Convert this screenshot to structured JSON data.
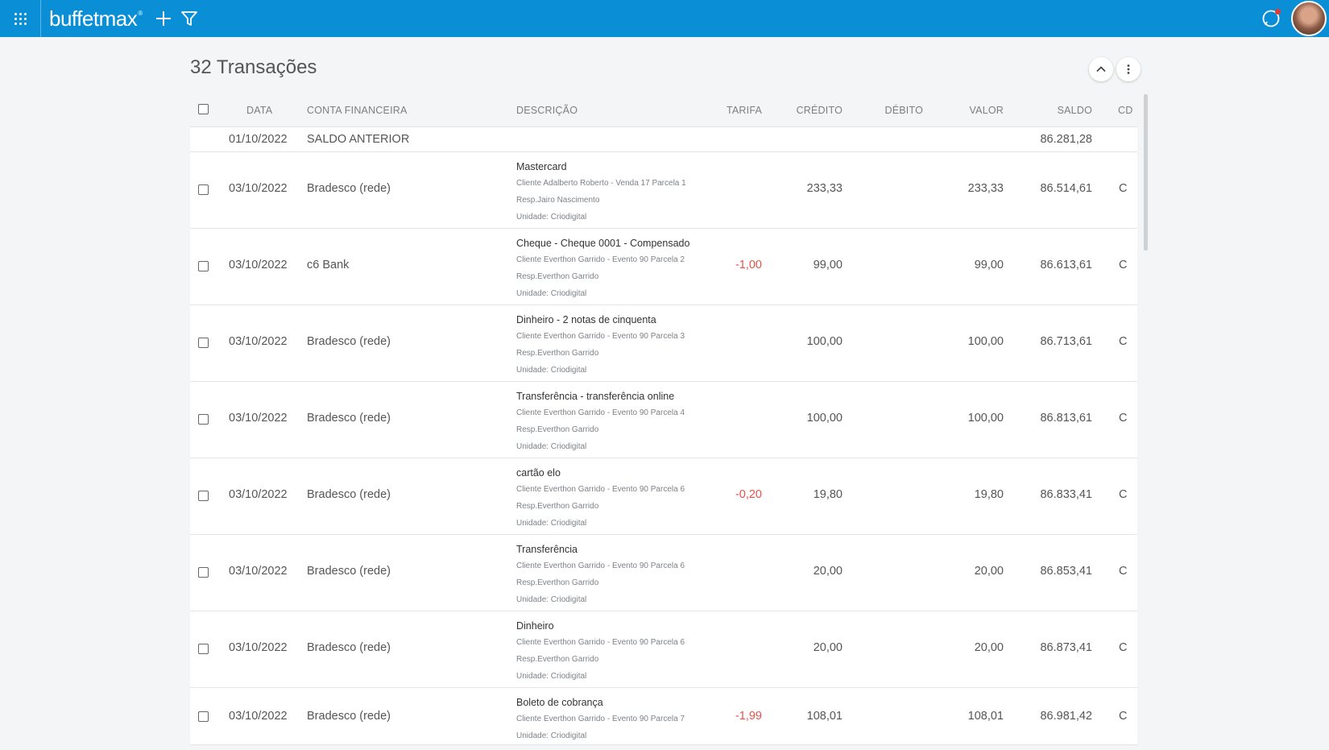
{
  "app": {
    "brand": "buffetmax",
    "brand_mark": "®"
  },
  "page": {
    "title": "32 Transações"
  },
  "table": {
    "headers": {
      "data": "DATA",
      "conta": "CONTA FINANCEIRA",
      "descricao": "DESCRIÇÃO",
      "tarifa": "TARIFA",
      "credito": "CRÉDITO",
      "debito": "DÉBITO",
      "valor": "VALOR",
      "saldo": "SALDO",
      "cd": "CD"
    },
    "opening": {
      "date": "01/10/2022",
      "label": "SALDO ANTERIOR",
      "saldo": "86.281,28"
    },
    "rows": [
      {
        "date": "03/10/2022",
        "account": "Bradesco (rede)",
        "desc": "Mastercard",
        "details": [
          "Cliente Adalberto Roberto - Venda 17 Parcela 1",
          "Resp.Jairo Nascimento",
          "Unidade: Criodigital"
        ],
        "tarifa": "",
        "credito": "233,33",
        "debito": "",
        "valor": "233,33",
        "saldo": "86.514,61",
        "cd": "C"
      },
      {
        "date": "03/10/2022",
        "account": "c6 Bank",
        "desc": "Cheque - Cheque 0001 - Compensado",
        "details": [
          "Cliente Everthon Garrido - Evento 90 Parcela 2",
          "Resp.Everthon Garrido",
          "Unidade: Criodigital"
        ],
        "tarifa": "-1,00",
        "credito": "99,00",
        "debito": "",
        "valor": "99,00",
        "saldo": "86.613,61",
        "cd": "C"
      },
      {
        "date": "03/10/2022",
        "account": "Bradesco (rede)",
        "desc": "Dinheiro - 2 notas de cinquenta",
        "details": [
          "Cliente Everthon Garrido - Evento 90 Parcela 3",
          "Resp.Everthon Garrido",
          "Unidade: Criodigital"
        ],
        "tarifa": "",
        "credito": "100,00",
        "debito": "",
        "valor": "100,00",
        "saldo": "86.713,61",
        "cd": "C"
      },
      {
        "date": "03/10/2022",
        "account": "Bradesco (rede)",
        "desc": "Transferência - transferência online",
        "details": [
          "Cliente Everthon Garrido - Evento 90 Parcela 4",
          "Resp.Everthon Garrido",
          "Unidade: Criodigital"
        ],
        "tarifa": "",
        "credito": "100,00",
        "debito": "",
        "valor": "100,00",
        "saldo": "86.813,61",
        "cd": "C"
      },
      {
        "date": "03/10/2022",
        "account": "Bradesco (rede)",
        "desc": "cartão elo",
        "details": [
          "Cliente Everthon Garrido - Evento 90 Parcela 6",
          "Resp.Everthon Garrido",
          "Unidade: Criodigital"
        ],
        "tarifa": "-0,20",
        "credito": "19,80",
        "debito": "",
        "valor": "19,80",
        "saldo": "86.833,41",
        "cd": "C"
      },
      {
        "date": "03/10/2022",
        "account": "Bradesco (rede)",
        "desc": "Transferência",
        "details": [
          "Cliente Everthon Garrido - Evento 90 Parcela 6",
          "Resp.Everthon Garrido",
          "Unidade: Criodigital"
        ],
        "tarifa": "",
        "credito": "20,00",
        "debito": "",
        "valor": "20,00",
        "saldo": "86.853,41",
        "cd": "C"
      },
      {
        "date": "03/10/2022",
        "account": "Bradesco (rede)",
        "desc": "Dinheiro",
        "details": [
          "Cliente Everthon Garrido - Evento 90 Parcela 6",
          "Resp.Everthon Garrido",
          "Unidade: Criodigital"
        ],
        "tarifa": "",
        "credito": "20,00",
        "debito": "",
        "valor": "20,00",
        "saldo": "86.873,41",
        "cd": "C"
      },
      {
        "date": "03/10/2022",
        "account": "Bradesco (rede)",
        "desc": "Boleto de cobrança",
        "details": [
          "Cliente Everthon Garrido - Evento 90 Parcela 7",
          "Unidade: Criodigital"
        ],
        "tarifa": "-1,99",
        "credito": "108,01",
        "debito": "",
        "valor": "108,01",
        "saldo": "86.981,42",
        "cd": "C"
      }
    ]
  },
  "icons": {
    "apps": "apps-grid-icon",
    "add": "plus-icon",
    "filter": "filter-icon",
    "chat": "chat-icon",
    "collapse": "chevron-up-icon",
    "more": "more-vertical-icon"
  },
  "colors": {
    "topbar": "#0a8fd6",
    "negative": "#e5534b",
    "notification": "#e53935"
  }
}
